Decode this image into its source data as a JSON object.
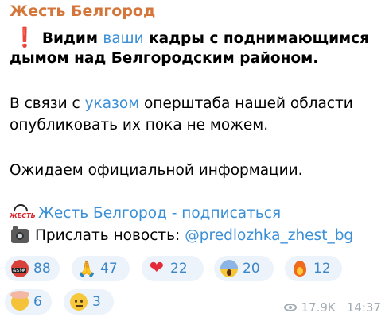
{
  "message": {
    "channel_name": "Жесть Белгород",
    "line1_before": "Видим ",
    "line1_link": "ваши",
    "line1_after": " кадры с поднимающимся",
    "line2": "дымом над Белгородским районом.",
    "line3_before": "В связи с ",
    "line3_link": "указом",
    "line3_after": " оперштаба нашей области",
    "line4": "опубликовать их пока не можем.",
    "line5": "Ожидаем официальной информации.",
    "subscribe_link": "Жесть Белгород - подписаться",
    "news_label": "Прислать новость:",
    "news_link": "@predlozhka_zhest_bg"
  },
  "reactions": [
    {
      "icon": "angry-face-cursing-icon",
      "count": "88"
    },
    {
      "icon": "folded-hands-icon",
      "count": "47"
    },
    {
      "icon": "heart-icon",
      "count": "22"
    },
    {
      "icon": "screaming-face-icon",
      "count": "20"
    },
    {
      "icon": "fire-icon",
      "count": "12"
    },
    {
      "icon": "exploding-head-icon",
      "count": "6"
    },
    {
      "icon": "neutral-face-icon",
      "count": "3"
    }
  ],
  "meta": {
    "views": "17.9K",
    "time": "14:37"
  },
  "colors": {
    "channel_name": "#d4763a",
    "link": "#3a8fd6",
    "reaction_bg": "#edf3fa",
    "meta": "#a3abb3"
  }
}
